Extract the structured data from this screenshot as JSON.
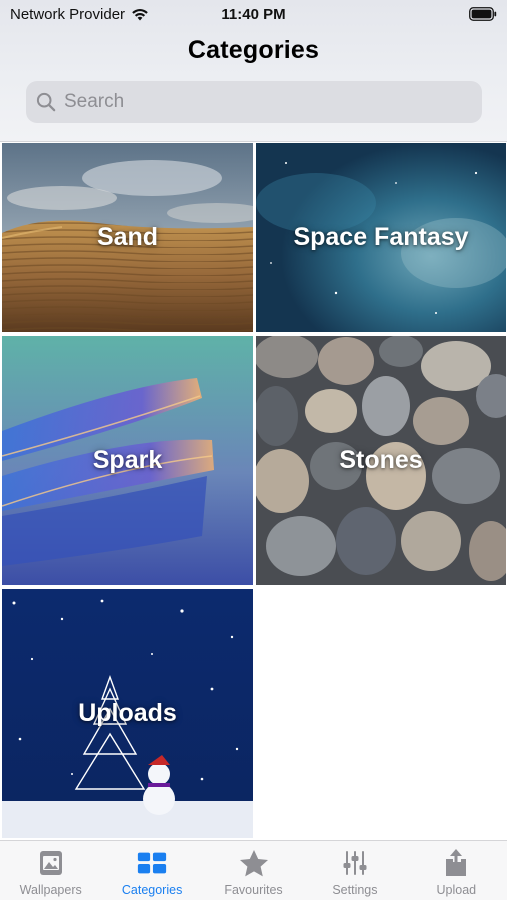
{
  "status_bar": {
    "carrier": "Network Provider",
    "time": "11:40 PM"
  },
  "header": {
    "title": "Categories"
  },
  "search": {
    "placeholder": "Search"
  },
  "categories": [
    {
      "label": "Sand"
    },
    {
      "label": "Space Fantasy"
    },
    {
      "label": "Spark"
    },
    {
      "label": "Stones"
    },
    {
      "label": "Uploads"
    }
  ],
  "tab_bar": {
    "active": "Categories",
    "active_color": "#1a7ff0",
    "inactive_color": "#8e8e93",
    "tabs": [
      {
        "label": "Wallpapers",
        "icon": "photo-icon"
      },
      {
        "label": "Categories",
        "icon": "grid-icon"
      },
      {
        "label": "Favourites",
        "icon": "star-icon"
      },
      {
        "label": "Settings",
        "icon": "sliders-icon"
      },
      {
        "label": "Upload",
        "icon": "share-upload-icon"
      }
    ]
  }
}
